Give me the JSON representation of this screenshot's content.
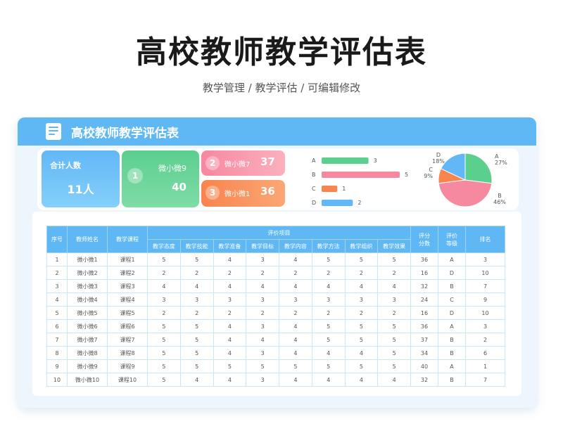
{
  "page": {
    "title": "高校教师教学评估表",
    "subtitle": "教学管理 / 教学评估 /  可编辑修改"
  },
  "card": {
    "title": "高校教师教学评估表"
  },
  "kpi": {
    "total_label": "合计人数",
    "total_value": "11人",
    "first": {
      "rank": "1",
      "name": "微小微9",
      "score": "40"
    },
    "second": {
      "rank": "2",
      "name": "微小微7",
      "score": "37"
    },
    "third": {
      "rank": "3",
      "name": "微小微1",
      "score": "36"
    }
  },
  "colors": {
    "A": "#5bcf8e",
    "B": "#f6889f",
    "C": "#f8844e",
    "D": "#62b7f6"
  },
  "chart_data": [
    {
      "type": "bar",
      "orientation": "horizontal",
      "categories": [
        "A",
        "B",
        "C",
        "D"
      ],
      "values": [
        3,
        5,
        1,
        2
      ]
    },
    {
      "type": "pie",
      "labels": [
        "A",
        "B",
        "C",
        "D"
      ],
      "values": [
        27,
        46,
        9,
        18
      ],
      "value_labels": [
        "27%",
        "46%",
        "9%",
        "18%"
      ]
    }
  ],
  "table": {
    "headers": {
      "no": "序号",
      "name": "教师姓名",
      "course": "教学课程",
      "group": "评价项目",
      "items": [
        "教学态度",
        "教学技能",
        "教学准备",
        "教学目标",
        "教学内容",
        "教学方法",
        "教学组织",
        "教学效果"
      ],
      "score": "评分分数",
      "grade": "评价等级",
      "rank": "排名"
    },
    "rows": [
      [
        "1",
        "微小微1",
        "课程1",
        "5",
        "5",
        "4",
        "3",
        "4",
        "5",
        "5",
        "5",
        "36",
        "A",
        "3"
      ],
      [
        "2",
        "微小微2",
        "课程2",
        "2",
        "2",
        "2",
        "2",
        "2",
        "2",
        "2",
        "2",
        "16",
        "D",
        "10"
      ],
      [
        "3",
        "微小微3",
        "课程3",
        "4",
        "4",
        "4",
        "4",
        "4",
        "4",
        "4",
        "4",
        "32",
        "B",
        "7"
      ],
      [
        "4",
        "微小微4",
        "课程4",
        "3",
        "3",
        "3",
        "3",
        "3",
        "3",
        "3",
        "3",
        "24",
        "C",
        "9"
      ],
      [
        "5",
        "微小微5",
        "课程5",
        "2",
        "2",
        "2",
        "2",
        "2",
        "2",
        "2",
        "2",
        "16",
        "D",
        "10"
      ],
      [
        "6",
        "微小微6",
        "课程6",
        "5",
        "5",
        "4",
        "3",
        "4",
        "5",
        "5",
        "5",
        "36",
        "A",
        "3"
      ],
      [
        "7",
        "微小微7",
        "课程7",
        "5",
        "5",
        "4",
        "4",
        "4",
        "5",
        "5",
        "5",
        "37",
        "B",
        "2"
      ],
      [
        "8",
        "微小微8",
        "课程8",
        "5",
        "5",
        "4",
        "3",
        "4",
        "4",
        "4",
        "5",
        "34",
        "B",
        "6"
      ],
      [
        "9",
        "微小微9",
        "课程9",
        "5",
        "5",
        "5",
        "5",
        "5",
        "5",
        "5",
        "5",
        "40",
        "A",
        "1"
      ],
      [
        "10",
        "微小微10",
        "课程10",
        "5",
        "4",
        "4",
        "3",
        "4",
        "4",
        "4",
        "4",
        "32",
        "B",
        "7"
      ]
    ]
  }
}
